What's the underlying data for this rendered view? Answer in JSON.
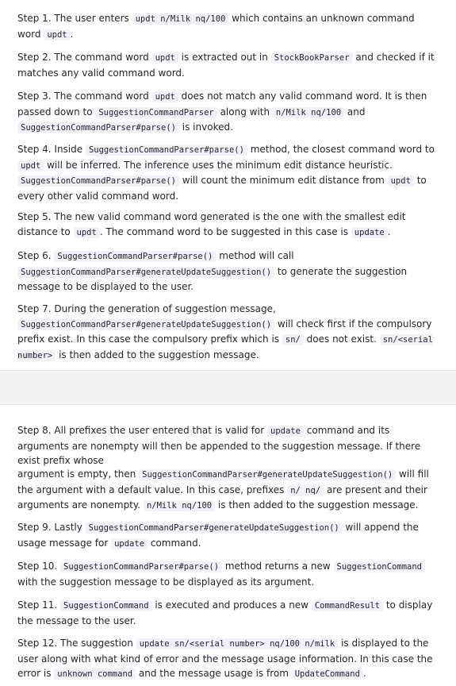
{
  "steps": {
    "s1": {
      "a": "Step 1. The user enters ",
      "c1": "updt n/Milk nq/100",
      "b": " which contains an unknown command word ",
      "c2": "updt",
      "d": "."
    },
    "s2": {
      "a": "Step 2. The command word ",
      "c1": "updt",
      "b": " is extracted out in ",
      "c2": "StockBookParser",
      "d": " and checked if it matches any valid command word."
    },
    "s3": {
      "a": "Step 3. The command word ",
      "c1": "updt",
      "b": " does not match any valid command word. It is then passed down to ",
      "c2": "SuggestionCommandParser",
      "d": " along with ",
      "c3": "n/Milk nq/100",
      "e": " and ",
      "c4": "SuggestionCommandParser#parse()",
      "f": " is invoked."
    },
    "s4": {
      "a": "Step 4. Inside ",
      "c1": "SuggestionCommandParser#parse()",
      "b": " method, the closest command word to ",
      "c2": "updt",
      "d": " will be inferred. The inference uses the minimum edit distance heuristic. ",
      "c3": "SuggestionCommandParser#parse()",
      "e": " will count the minimum edit distance from ",
      "c4": "updt",
      "f": " to every other valid command word."
    },
    "s5": {
      "a": "Step 5. The new valid command word generated is the one with the smallest edit distance to ",
      "c1": "updt",
      "b": ". The command word to be suggested in this case is ",
      "c2": "update",
      "d": "."
    },
    "s6": {
      "a": "Step 6. ",
      "c1": "SuggestionCommandParser#parse()",
      "b": " method will call ",
      "c2": "SuggestionCommandParser#generateUpdateSuggestion()",
      "d": " to generate the suggestion message to be displayed to the user."
    },
    "s7": {
      "a": "Step 7. During the generation of suggestion message, ",
      "c1": "SuggestionCommandParser#generateUpdateSuggestion()",
      "b": " will check first if the compulsory prefix exist. In this case the compulsory prefix which is ",
      "c2": "sn/",
      "d": " does not exist. ",
      "c3": "sn/<serial number>",
      "e": " is then added to the suggestion message."
    },
    "s8": {
      "a": "Step 8. All prefixes the user entered that is valid for ",
      "c1": "update",
      "b": " command and its arguments are nonempty will then be appended to the suggestion message. If there exist prefix whose"
    },
    "s8b": {
      "a": "argument is empty, then ",
      "c1": "SuggestionCommandParser#generateUpdateSuggestion()",
      "b": " will fill the argument with a default value. In this case, prefixes ",
      "c2": "n/ nq/",
      "d": " are present and their arguments are nonempty. ",
      "c3": "n/Milk nq/100",
      "e": " is then added to the suggestion message."
    },
    "s9": {
      "a": "Step 9. Lastly ",
      "c1": "SuggestionCommandParser#generateUpdateSuggestion()",
      "b": " will append the usage message for ",
      "c2": "update",
      "d": " command."
    },
    "s10": {
      "a": "Step 10. ",
      "c1": "SuggestionCommandParser#parse()",
      "b": " method returns a new ",
      "c2": "SuggestionCommand",
      "d": " with the suggestion message to be displayed as its argument."
    },
    "s11": {
      "a": "Step 11. ",
      "c1": "SuggestionCommand",
      "b": " is executed and produces a new ",
      "c2": "CommandResult",
      "d": " to display the message to the user."
    },
    "s12": {
      "a": "Step 12. The suggestion ",
      "c1": "update sn/<serial number> nq/100 n/milk",
      "b": " is displayed to the user along with what kind of error and the message usage information. In this case the error is ",
      "c2": "unknown command",
      "d": " and the message usage is from ",
      "c3": "UpdateCommand",
      "e": "."
    }
  }
}
